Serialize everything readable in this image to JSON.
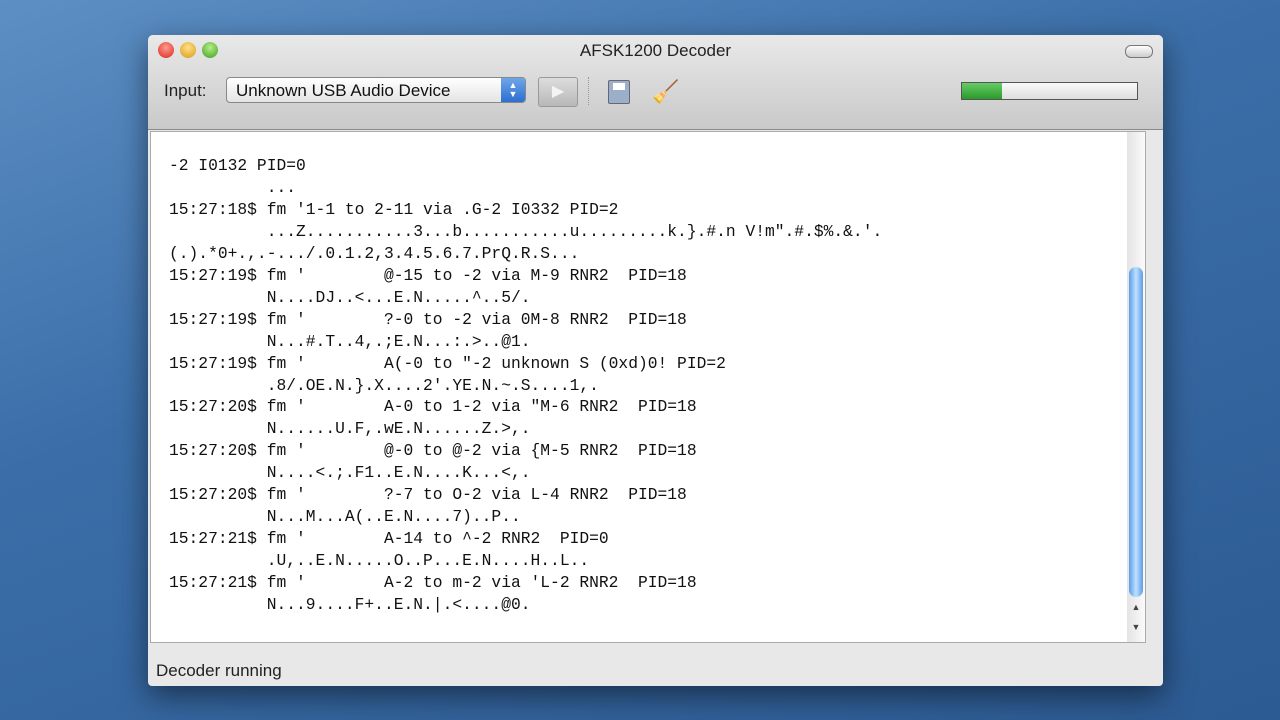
{
  "window": {
    "title": "AFSK1200 Decoder"
  },
  "toolbar": {
    "input_label": "Input:",
    "input_value": "Unknown USB Audio Device",
    "play_icon": "play-icon",
    "save_icon": "save-icon",
    "clear_icon": "broom-icon",
    "level_percent": 23
  },
  "log": {
    "lines": [
      "-2 I0132 PID=0",
      "          ...",
      "15:27:18$ fm '1-1 to 2-11 via .G-2 I0332 PID=2",
      "          ...Z...........3...b...........u.........k.}.#.n V!m\".#.$%.&.'.",
      "(.).*0+.,.-.../.0.1.2,3.4.5.6.7.PrQ.R.S...",
      "15:27:19$ fm '        @-15 to -2 via M-9 RNR2  PID=18",
      "          N....DJ..<...E.N.....^..5/.",
      "15:27:19$ fm '        ?-0 to -2 via 0M-8 RNR2  PID=18",
      "          N...#.T..4,.;E.N...:.>..@1.",
      "15:27:19$ fm '        A(-0 to \"-2 unknown S (0xd)0! PID=2",
      "          .8/.OE.N.}.X....2'.YE.N.~.S....1,.",
      "15:27:20$ fm '        A-0 to 1-2 via \"M-6 RNR2  PID=18",
      "          N......U.F,.wE.N......Z.>,.",
      "15:27:20$ fm '        @-0 to @-2 via {M-5 RNR2  PID=18",
      "          N....<.;.F1..E.N....K...<,.",
      "15:27:20$ fm '        ?-7 to O-2 via L-4 RNR2  PID=18",
      "          N...M...A(..E.N....7)..P..",
      "15:27:21$ fm '        A-14 to ^-2 RNR2  PID=0",
      "          .U,..E.N.....O..P...E.N....H..L..",
      "15:27:21$ fm '        A-2 to m-2 via 'L-2 RNR2  PID=18",
      "          N...9....F+..E.N.|.<....@0."
    ]
  },
  "status": {
    "text": "Decoder running"
  }
}
